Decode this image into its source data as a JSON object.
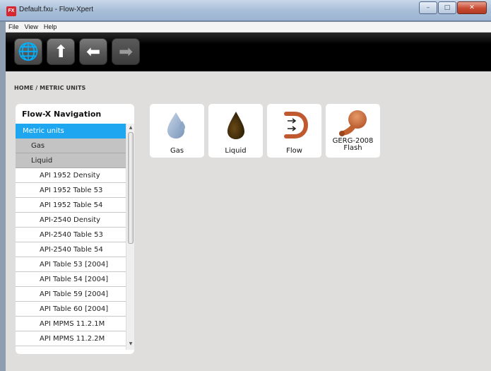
{
  "window": {
    "title": "Default.fxu - Flow-Xpert",
    "app_badge": "FX",
    "minimize": "–",
    "maximize": "□",
    "close": "✕"
  },
  "menu": [
    "File",
    "View",
    "Help"
  ],
  "toolbar": {
    "buttons": [
      {
        "name": "globe",
        "glyph": "🌐"
      },
      {
        "name": "up",
        "glyph": "⬆"
      },
      {
        "name": "back",
        "glyph": "⬅"
      },
      {
        "name": "forward",
        "glyph": "➡"
      }
    ]
  },
  "breadcrumb": "HOME / METRIC UNITS",
  "nav": {
    "title": "Flow-X Navigation",
    "active": "Metric units",
    "groups": [
      "Gas",
      "Liquid"
    ],
    "items": [
      "API 1952 Density",
      "API 1952 Table 53",
      "API 1952 Table 54",
      "API-2540 Density",
      "API-2540 Table 53",
      "API-2540 Table 54",
      "API Table 53 [2004]",
      "API Table 54 [2004]",
      "API Table 59 [2004]",
      "API Table 60 [2004]",
      "API MPMS 11.2.1M",
      "API MPMS 11.2.2M"
    ]
  },
  "tiles": [
    {
      "label": "Gas",
      "icon": "gas-drop-icon"
    },
    {
      "label": "Liquid",
      "icon": "liquid-drop-icon"
    },
    {
      "label": "Flow",
      "icon": "flow-pipe-icon"
    },
    {
      "label_line1": "GERG-2008",
      "label_line2": "Flash",
      "icon": "flask-icon"
    }
  ],
  "colors": {
    "active_blue": "#1ea7f0",
    "flow_orange": "#c0592f",
    "flask_orange": "#c96a35"
  }
}
